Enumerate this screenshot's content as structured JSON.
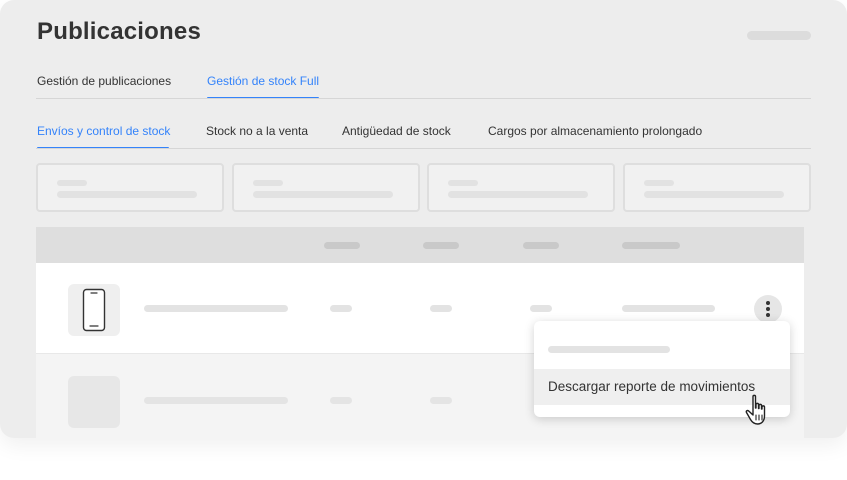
{
  "page": {
    "title": "Publicaciones"
  },
  "main_tabs": [
    {
      "label": "Gestión de publicaciones",
      "active": false
    },
    {
      "label": "Gestión de stock Full",
      "active": true
    }
  ],
  "sub_tabs": [
    {
      "label": "Envíos y control de stock",
      "active": true
    },
    {
      "label": "Stock no a la venta",
      "active": false
    },
    {
      "label": "Antigüedad de stock",
      "active": false
    },
    {
      "label": "Cargos por almacenamiento prolongado",
      "active": false
    }
  ],
  "context_menu": {
    "items": [
      {
        "label": "Descargar reporte de movimientos",
        "hovered": true
      }
    ]
  },
  "icons": {
    "product": "smartphone-icon",
    "actions": "more-vertical-icon",
    "cursor": "hand-pointer-icon"
  },
  "colors": {
    "accent": "#3483fa",
    "background": "#ededed",
    "text": "#333333"
  }
}
